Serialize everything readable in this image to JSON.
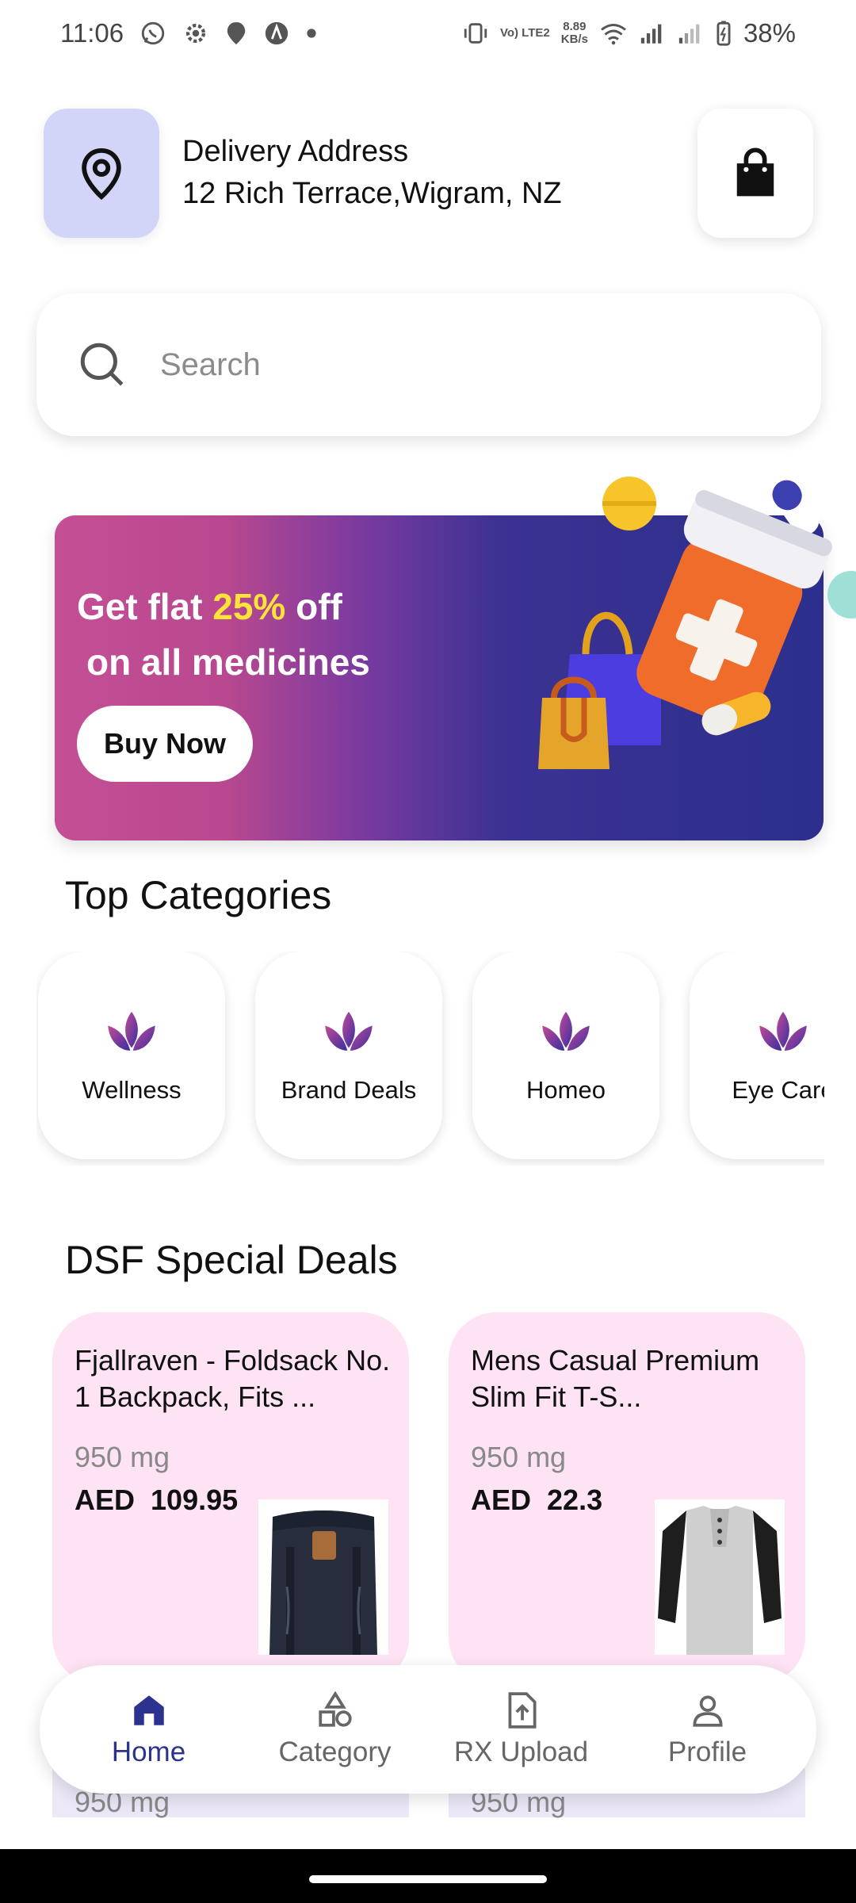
{
  "status_bar": {
    "time": "11:06",
    "net_speed_value": "8.89",
    "net_speed_unit": "KB/s",
    "volte_label": "Vo) LTE2",
    "battery": "38%"
  },
  "header": {
    "delivery_label": "Delivery Address",
    "delivery_address": "12 Rich Terrace,Wigram, NZ",
    "location_icon": "map-pin-icon",
    "cart_icon": "shopping-bag-icon"
  },
  "search": {
    "placeholder": "Search",
    "icon": "search-icon"
  },
  "banner": {
    "line1_prefix": "Get flat ",
    "line1_highlight": "25%",
    "line1_suffix": " off",
    "line2": "on all medicines",
    "button_label": "Buy Now",
    "highlight_color": "#ffe23a"
  },
  "categories": {
    "title": "Top Categories",
    "items": [
      {
        "label": "Wellness"
      },
      {
        "label": "Brand Deals"
      },
      {
        "label": "Homeo"
      },
      {
        "label": "Eye Care"
      }
    ]
  },
  "deals": {
    "title": "DSF Special Deals",
    "items": [
      {
        "name": "Fjallraven - Foldsack No. 1 Backpack, Fits ...",
        "qty": "950 mg",
        "currency": "AED",
        "price": "109.95"
      },
      {
        "name": "Mens Casual Premium Slim Fit T-S...",
        "qty": "950 mg",
        "currency": "AED",
        "price": "22.3"
      }
    ],
    "peek_qty": [
      "950 mg",
      "950 mg"
    ]
  },
  "bottom_nav": {
    "items": [
      {
        "label": "Home",
        "icon": "home-icon",
        "active": true
      },
      {
        "label": "Category",
        "icon": "category-shapes-icon",
        "active": false
      },
      {
        "label": "RX Upload",
        "icon": "file-upload-icon",
        "active": false
      },
      {
        "label": "Profile",
        "icon": "profile-icon",
        "active": false
      }
    ],
    "active_color": "#2c338f"
  }
}
